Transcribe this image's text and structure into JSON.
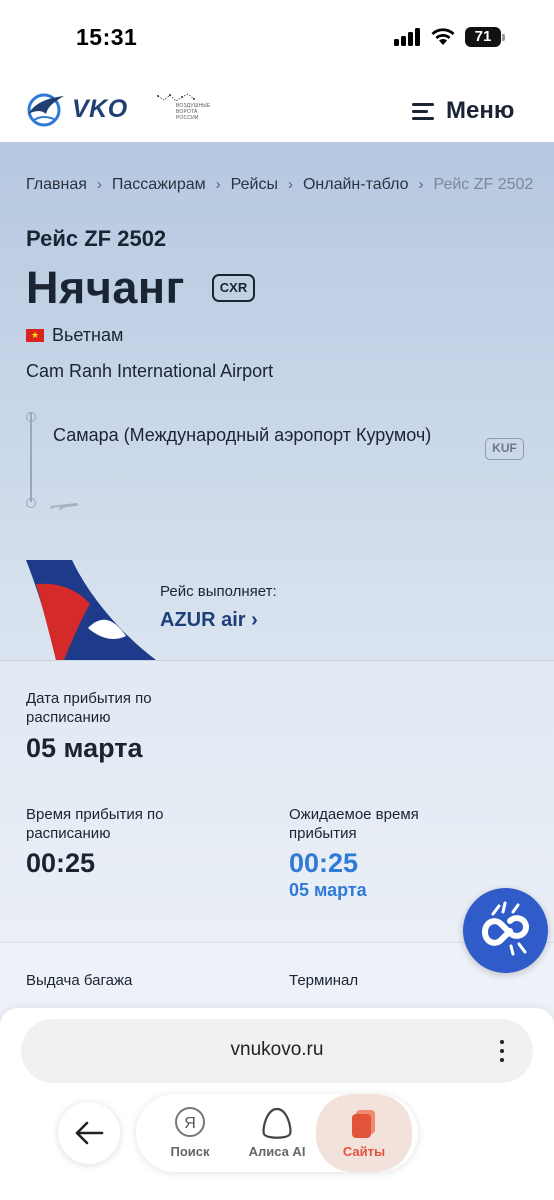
{
  "status_bar": {
    "time": "15:31",
    "battery": "71"
  },
  "header": {
    "logo_text": "VKO",
    "partner_logo_text": "ВОЗДУШНЫЕ ВОРОТА РОССИИ",
    "menu_label": "Меню"
  },
  "breadcrumb": {
    "items": [
      "Главная",
      "Пассажирам",
      "Рейсы",
      "Онлайн-табло"
    ],
    "current": "Рейс ZF 2502"
  },
  "flight": {
    "title": "Рейс ZF 2502",
    "destination_city": "Нячанг",
    "destination_code": "CXR",
    "country": "Вьетнам",
    "destination_airport": "Cam Ranh International Airport",
    "origin_name": "Самара (Международный аэропорт Курумоч)",
    "origin_code": "KUF"
  },
  "operator": {
    "label": "Рейс выполняет:",
    "name": "AZUR air ›"
  },
  "details": {
    "arrival_date_label": "Дата прибытия по расписанию",
    "arrival_date": "05 марта",
    "arrival_time_label": "Время прибытия по расписанию",
    "arrival_time": "00:25",
    "expected_label": "Ожидаемое время прибытия",
    "expected_time": "00:25",
    "expected_date": "05 марта",
    "baggage_label": "Выдача багажа",
    "terminal_label": "Терминал"
  },
  "browser": {
    "url": "vnukovo.ru",
    "tools": [
      {
        "label": "Поиск",
        "icon": "yandex-icon"
      },
      {
        "label": "Алиса AI",
        "icon": "alice-icon"
      },
      {
        "label": "Сайты",
        "icon": "sites-icon"
      }
    ]
  },
  "colors": {
    "accent_blue": "#2f7ad6",
    "brand_navy": "#1e3f7a",
    "hero_bg": "#c9d7e9",
    "chat_blue": "#2f5cc8",
    "active_tab": "#e2543a"
  }
}
